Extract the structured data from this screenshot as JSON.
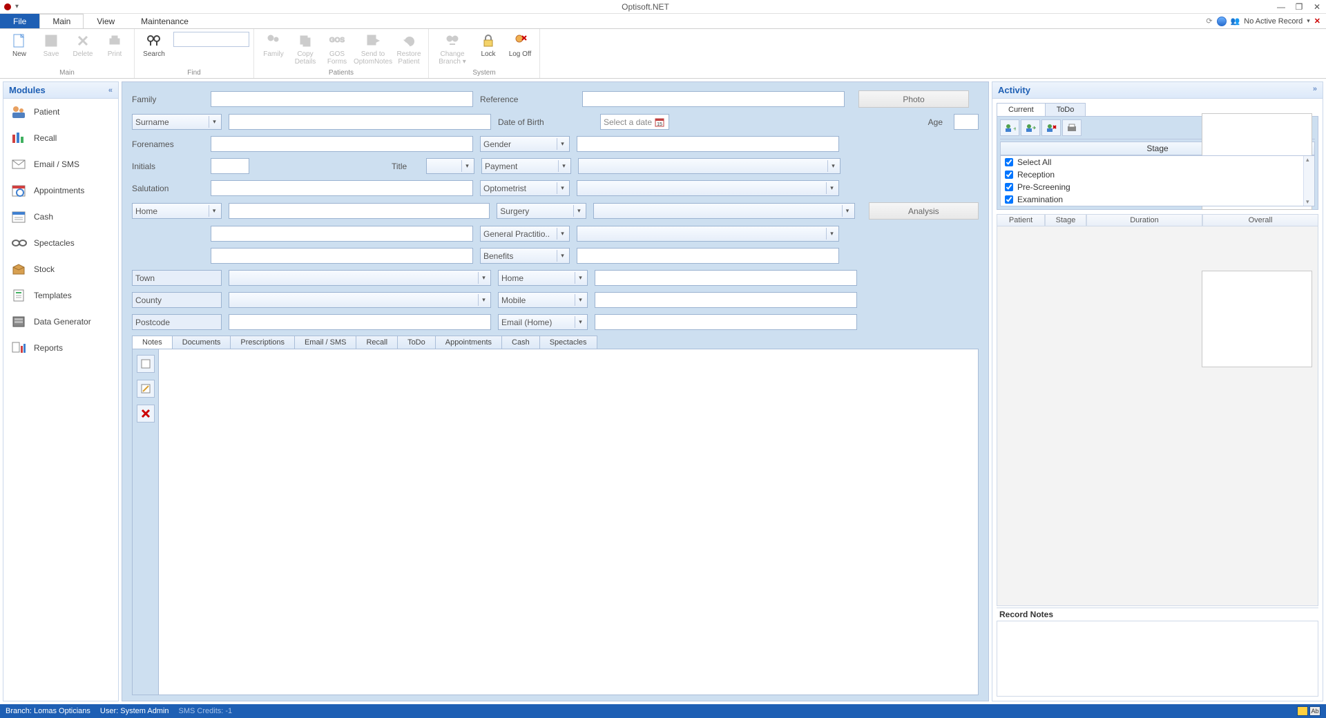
{
  "app": {
    "title": "Optisoft.NET",
    "status_right": "No Active Record"
  },
  "menutabs": {
    "file": "File",
    "main": "Main",
    "view": "View",
    "maintenance": "Maintenance"
  },
  "ribbon": {
    "main": {
      "new": "New",
      "save": "Save",
      "delete": "Delete",
      "print": "Print",
      "group": "Main"
    },
    "find": {
      "search": "Search",
      "group": "Find"
    },
    "patients": {
      "family": "Family",
      "copy": "Copy Details",
      "gos": "GOS Forms",
      "send": "Send to OptomNotes",
      "restore": "Restore Patient",
      "group": "Patients"
    },
    "system": {
      "change": "Change Branch ▾",
      "lock": "Lock",
      "logoff": "Log Off",
      "group": "System"
    }
  },
  "modules": {
    "title": "Modules",
    "items": [
      "Patient",
      "Recall",
      "Email / SMS",
      "Appointments",
      "Cash",
      "Spectacles",
      "Stock",
      "Templates",
      "Data Generator",
      "Reports"
    ]
  },
  "form": {
    "family": "Family",
    "reference": "Reference",
    "photo": "Photo",
    "surname": "Surname",
    "dob": "Date of Birth",
    "selectdate": "Select a date",
    "age": "Age",
    "forenames": "Forenames",
    "gender": "Gender",
    "initials": "Initials",
    "title": "Title",
    "payment": "Payment",
    "salutation": "Salutation",
    "optometrist": "Optometrist",
    "addrtype": "Home",
    "surgery": "Surgery",
    "analysis": "Analysis",
    "gp": "General Practitio..",
    "benefits": "Benefits",
    "town": "Town",
    "phonehome": "Home",
    "county": "County",
    "mobile": "Mobile",
    "postcode": "Postcode",
    "emailhome": "Email (Home)"
  },
  "lowertabs": [
    "Notes",
    "Documents",
    "Prescriptions",
    "Email / SMS",
    "Recall",
    "ToDo",
    "Appointments",
    "Cash",
    "Spectacles"
  ],
  "activity": {
    "title": "Activity",
    "tabs": {
      "current": "Current",
      "todo": "ToDo"
    },
    "stage": "Stage",
    "checks": [
      "Select All",
      "Reception",
      "Pre-Screening",
      "Examination"
    ],
    "cols": [
      "Patient",
      "Stage",
      "Duration",
      "Overall"
    ],
    "recnotes": "Record Notes"
  },
  "status": {
    "branch": "Branch: Lomas Opticians",
    "user": "User: System Admin",
    "sms": "SMS Credits: -1"
  }
}
